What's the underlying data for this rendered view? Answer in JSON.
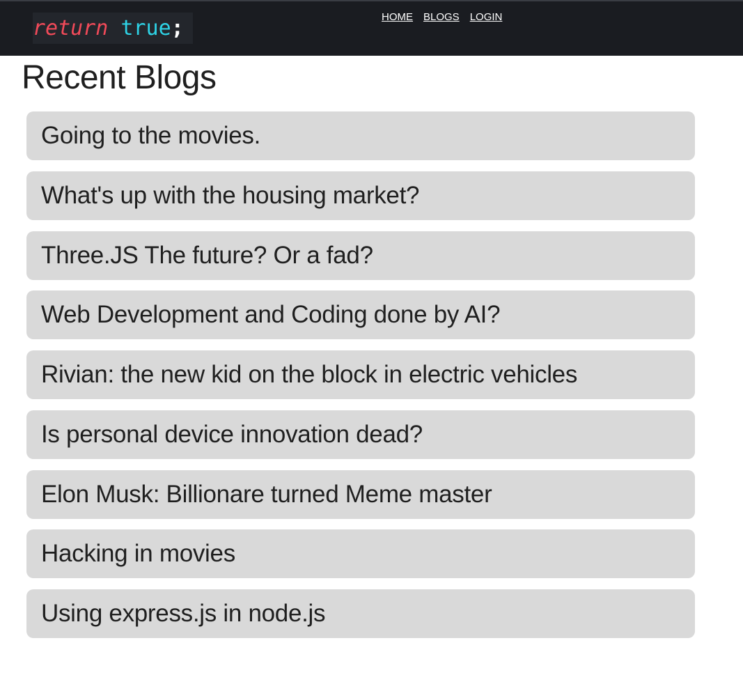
{
  "header": {
    "logo": {
      "keyword": "return",
      "value": "true",
      "terminator": ";"
    },
    "nav": [
      {
        "label": "HOME"
      },
      {
        "label": "BLOGS"
      },
      {
        "label": "LOGIN"
      }
    ]
  },
  "main": {
    "title": "Recent Blogs",
    "blogs": [
      {
        "title": "Going to the movies."
      },
      {
        "title": "What's up with the housing market?"
      },
      {
        "title": "Three.JS The future? Or a fad?"
      },
      {
        "title": "Web Development and Coding done by AI?"
      },
      {
        "title": "Rivian: the new kid on the block in electric vehicles"
      },
      {
        "title": "Is personal device innovation dead?"
      },
      {
        "title": "Elon Musk: Billionare turned Meme master"
      },
      {
        "title": "Hacking in movies"
      },
      {
        "title": "Using express.js in node.js"
      }
    ]
  },
  "colors": {
    "header_background": "#1a1c21",
    "logo_background": "#23262c",
    "keyword": "#f24a59",
    "value": "#2ed3e6",
    "card_background": "#d9d9d9"
  }
}
